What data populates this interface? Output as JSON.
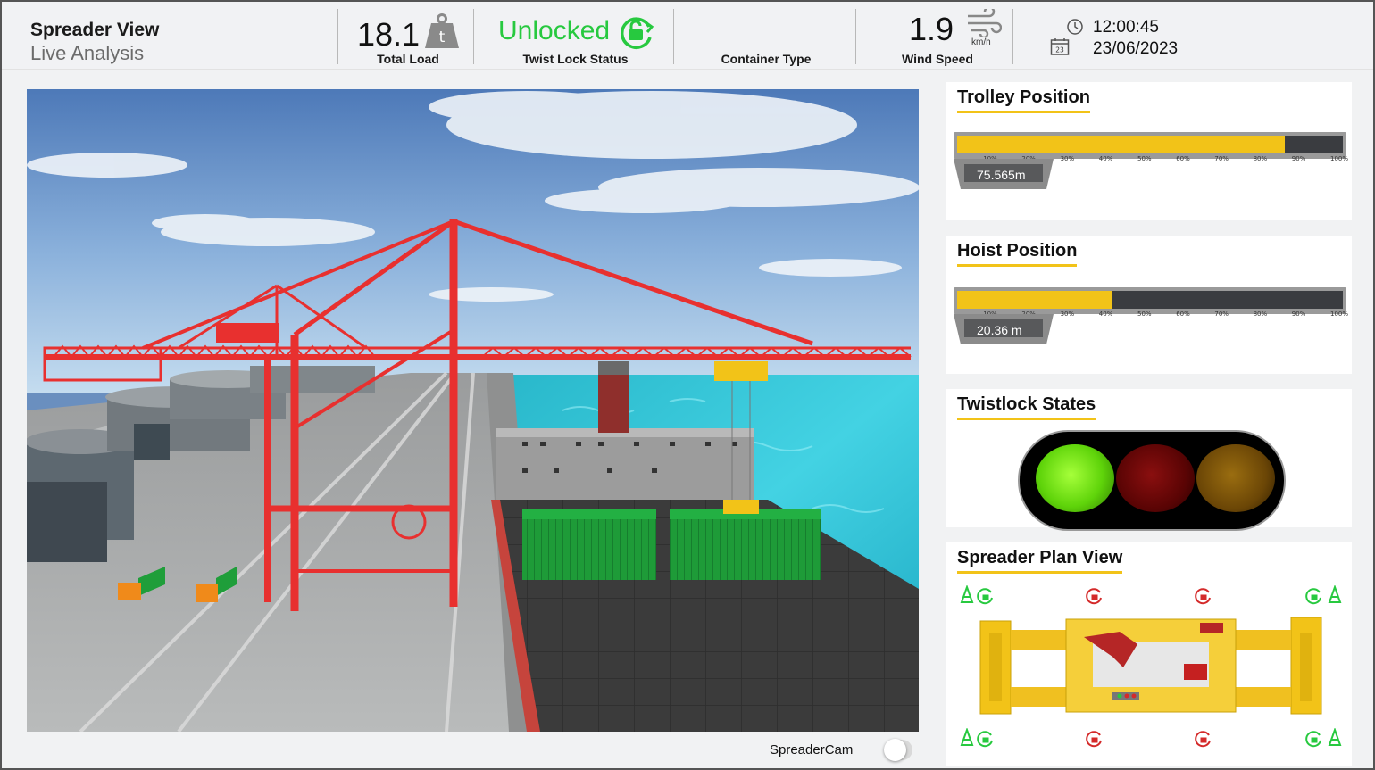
{
  "header": {
    "title": "Spreader View",
    "subtitle": "Live Analysis",
    "total_load": {
      "value": "18.1",
      "unit": "t",
      "label": "Total Load"
    },
    "twist_lock": {
      "value": "Unlocked",
      "label": "Twist Lock Status"
    },
    "container_type": {
      "value": "",
      "label": "Container Type"
    },
    "wind_speed": {
      "value": "1.9",
      "unit": "km/h",
      "label": "Wind Speed"
    },
    "time": "12:00:45",
    "date": "23/06/2023",
    "calendar_day": "23"
  },
  "colors": {
    "accent": "#f2c318",
    "status_green": "#27c93f",
    "lock_red": "#d42a2a",
    "crane_red": "#e8302f"
  },
  "icons": [
    "weight-icon",
    "unlock-icon",
    "wind-icon",
    "clock-icon",
    "calendar-icon",
    "lock-icon",
    "cone-icon"
  ],
  "panels": {
    "trolley": {
      "title": "Trolley Position",
      "value": "75.565m",
      "fill_fraction": 0.85,
      "scale": [
        "10%",
        "20%",
        "30%",
        "40%",
        "50%",
        "60%",
        "70%",
        "80%",
        "90%",
        "100%"
      ]
    },
    "hoist": {
      "title": "Hoist Position",
      "value": "20.36 m",
      "fill_fraction": 0.4,
      "scale": [
        "10%",
        "20%",
        "30%",
        "40%",
        "50%",
        "60%",
        "70%",
        "80%",
        "90%",
        "100%"
      ]
    },
    "twistlock": {
      "title": "Twistlock States",
      "lights": [
        {
          "name": "green",
          "state": "on"
        },
        {
          "name": "red",
          "state": "off"
        },
        {
          "name": "amber",
          "state": "off"
        }
      ]
    },
    "plan": {
      "title": "Spreader Plan View",
      "top_row": [
        "unlocked",
        "locked",
        "locked",
        "unlocked"
      ],
      "bottom_row": [
        "unlocked",
        "locked",
        "locked",
        "unlocked"
      ]
    }
  },
  "spreader_cam": {
    "label": "SpreaderCam",
    "on": false
  }
}
